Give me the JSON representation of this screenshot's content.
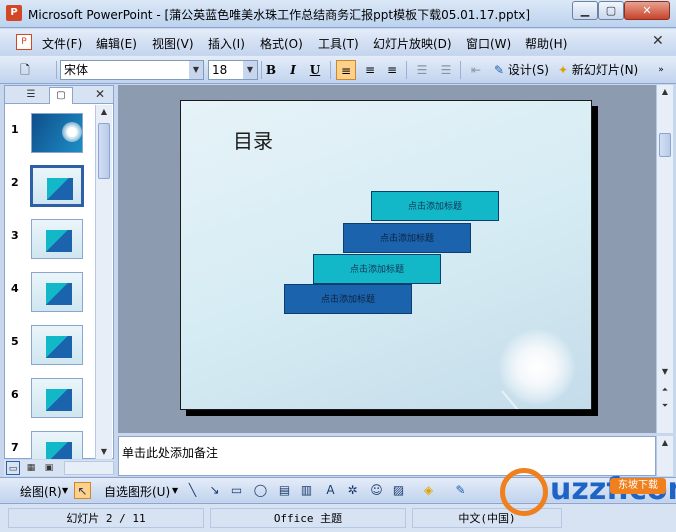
{
  "window": {
    "title": "Microsoft PowerPoint - [蒲公英蓝色唯美水珠工作总结商务汇报ppt模板下载05.01.17.pptx]",
    "min_label": "▁",
    "max_label": "▢",
    "close_label": "✕"
  },
  "menu": {
    "items": [
      "文件(F)",
      "编辑(E)",
      "视图(V)",
      "插入(I)",
      "格式(O)",
      "工具(T)",
      "幻灯片放映(D)",
      "窗口(W)",
      "帮助(H)"
    ],
    "close": "✕"
  },
  "toolbar": {
    "font_name": "宋体",
    "font_size": "18",
    "bold": "B",
    "italic": "I",
    "underline": "U",
    "design_label": "设计(S)",
    "new_slide_label": "新幻灯片(N)"
  },
  "left_pane": {
    "close": "✕",
    "slide_numbers": [
      "1",
      "2",
      "3",
      "4",
      "5",
      "6",
      "7"
    ],
    "selected_slide": 2
  },
  "slide": {
    "title": "目录",
    "steps": [
      "点击添加标题",
      "点击添加标题",
      "点击添加标题",
      "点击添加标题"
    ]
  },
  "notes": {
    "placeholder": "单击此处添加备注"
  },
  "drawing_toolbar": {
    "draw_label": "绘图(R)",
    "autoshapes_label": "自选图形(U)"
  },
  "status": {
    "slide_position": "幻灯片 2 / 11",
    "theme": "Office 主题",
    "language": "中文(中国)"
  },
  "watermark": {
    "text": "uzzf.com",
    "badge": "东坡下载"
  },
  "colors": {
    "teal_box": "#12b8c7",
    "blue_box": "#1b63ad",
    "titlebar": "#bcd2ee"
  }
}
